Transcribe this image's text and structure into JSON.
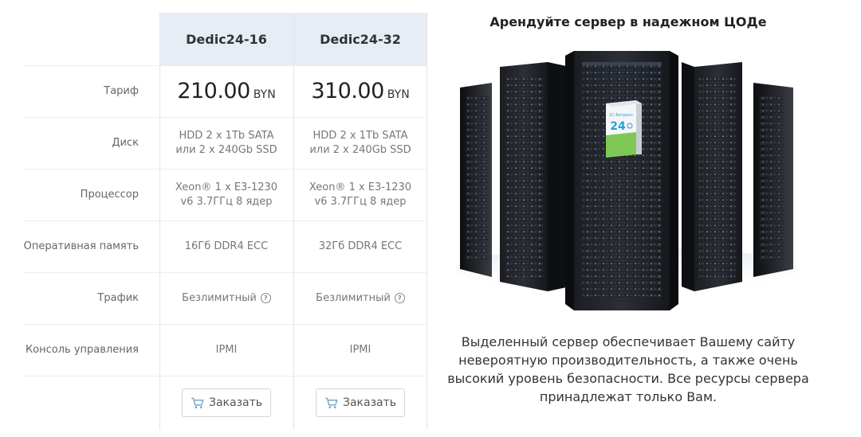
{
  "plans": [
    {
      "name": "Dedic24-16",
      "price": "210.00",
      "currency": "BYN",
      "disk": "HDD 2 x 1Tb SATA или 2 x 240Gb SSD",
      "cpu": "Xeon® 1 x E3-1230 v6 3.7ГГц 8 ядер",
      "ram": "16Гб DDR4 ECC",
      "traffic": "Безлимитный",
      "console": "IPMI",
      "order_label": "Заказать"
    },
    {
      "name": "Dedic24-32",
      "price": "310.00",
      "currency": "BYN",
      "disk": "HDD 2 x 1Tb SATA или 2 x 240Gb SSD",
      "cpu": "Xeon® 1 x E3-1230 v6 3.7ГГц 8 ядер",
      "ram": "32Гб DDR4 ECC",
      "traffic": "Безлимитный",
      "console": "IPMI",
      "order_label": "Заказать"
    }
  ],
  "row_labels": {
    "tariff": "Тариф",
    "disk": "Диск",
    "cpu": "Процессор",
    "ram": "Оперативная память",
    "traffic": "Трафик",
    "console": "Консоль управления"
  },
  "promo": {
    "title": "Арендуйте сервер в надежном ЦОДе",
    "box_brand": "1С-Битрикс",
    "box_number": "24",
    "text": "Выделенный сервер обеспечивает Вашему сайту невероятную производительность, а также очень высокий уровень безопасности. Все ресурсы сервера принадлежат только Вам."
  },
  "icons": {
    "help": "question-circle-icon",
    "cart": "cart-icon"
  },
  "colors": {
    "header_bg": "#e6edf5",
    "border": "#e4e4e4",
    "accent_blue": "#2a9fd6",
    "accent_green": "#6bbf3a"
  }
}
